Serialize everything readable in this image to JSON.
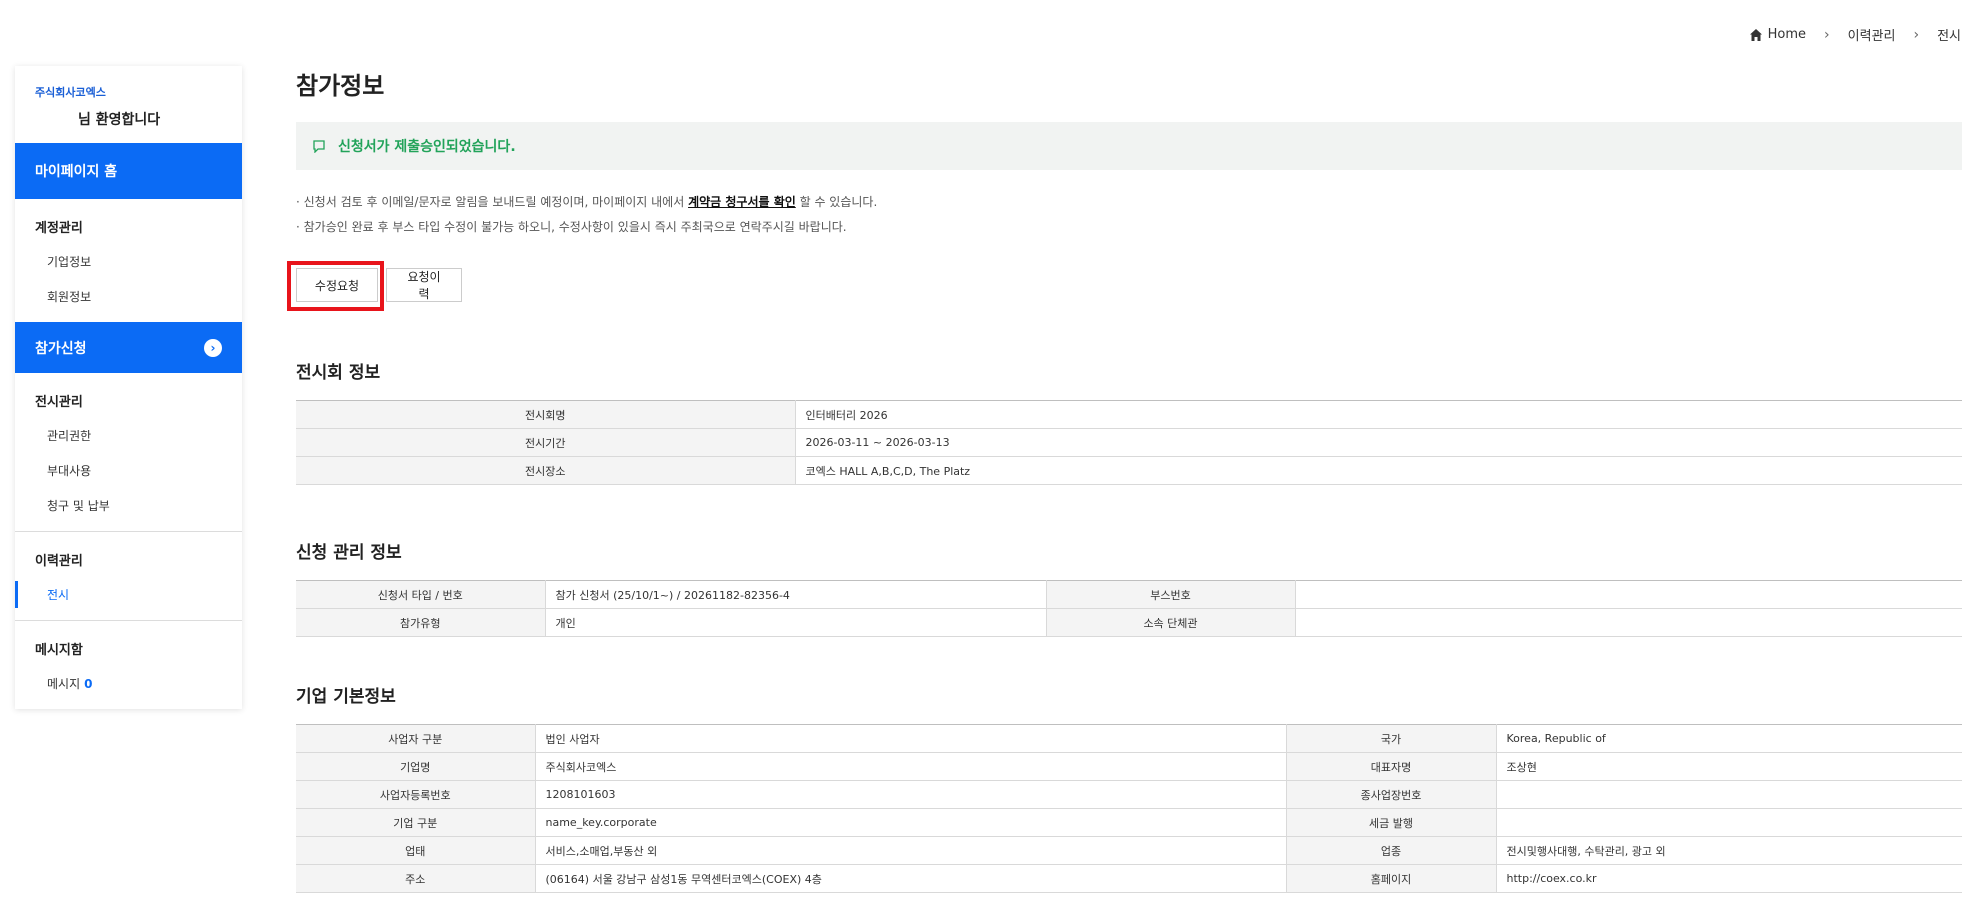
{
  "breadcrumb": {
    "home": "Home",
    "level1": "이력관리",
    "level2": "전시"
  },
  "sidebar": {
    "company": "주식회사코엑스",
    "welcome": "님 환영합니다",
    "mypage_home": "마이페이지 홈",
    "account": {
      "title": "계정관리",
      "items": [
        "기업정보",
        "회원정보"
      ]
    },
    "apply": "참가신청",
    "exhibit": {
      "title": "전시관리",
      "items": [
        "관리권한",
        "부대사용",
        "청구 및 납부"
      ]
    },
    "history": {
      "title": "이력관리",
      "items": [
        "전시"
      ]
    },
    "message": {
      "title": "메시지함",
      "label": "메시지",
      "count": "0"
    }
  },
  "main": {
    "title": "참가정보",
    "notice": "신청서가 제출승인되었습니다.",
    "guide1_pre": "· 신청서 검토 후 이메일/문자로 알림을 보내드릴 예정이며, 마이페이지 내에서 ",
    "guide1_link": "계약금 청구서를 확인",
    "guide1_post": " 할 수 있습니다.",
    "guide2": "· 참가승인 완료 후 부스 타입 수정이 불가능 하오니, 수정사항이 있을시 즉시 주최국으로 연락주시길 바랍니다.",
    "btn_edit": "수정요청",
    "btn_history": "요청이력"
  },
  "exhibition": {
    "title": "전시회 정보",
    "rows": [
      {
        "label": "전시회명",
        "value": "인터배터리 2026"
      },
      {
        "label": "전시기간",
        "value": "2026-03-11 ~ 2026-03-13"
      },
      {
        "label": "전시장소",
        "value": "코엑스 HALL A,B,C,D, The Platz"
      }
    ]
  },
  "application": {
    "title": "신청 관리 정보",
    "rows": [
      {
        "l1": "신청서 타입 / 번호",
        "v1": "참가 신청서 (25/10/1~) / 20261182-82356-4",
        "l2": "부스번호",
        "v2": ""
      },
      {
        "l1": "참가유형",
        "v1": "개인",
        "l2": "소속 단체관",
        "v2": ""
      }
    ]
  },
  "company": {
    "title": "기업 기본정보",
    "rows": [
      {
        "l1": "사업자 구분",
        "v1": "법인 사업자",
        "l2": "국가",
        "v2": "Korea, Republic of"
      },
      {
        "l1": "기업명",
        "v1": "주식회사코엑스",
        "l2": "대표자명",
        "v2": "조상현"
      },
      {
        "l1": "사업자등록번호",
        "v1": "1208101603",
        "l2": "종사업장번호",
        "v2": ""
      },
      {
        "l1": "기업 구분",
        "v1": "name_key.corporate",
        "l2": "세금 발행",
        "v2": ""
      },
      {
        "l1": "업태",
        "v1": "서비스,소매업,부동산 외",
        "l2": "업종",
        "v2": "전시및행사대행, 수탁관리, 광고 외"
      },
      {
        "l1": "주소",
        "v1": "(06164) 서울 강남구 삼성1동 무역센터코엑스(COEX) 4층",
        "l2": "홈페이지",
        "v2": "http://coex.co.kr"
      }
    ]
  },
  "colors": {
    "primary": "#0b6bf5",
    "success": "#22a35a",
    "highlight": "#e8141b"
  }
}
